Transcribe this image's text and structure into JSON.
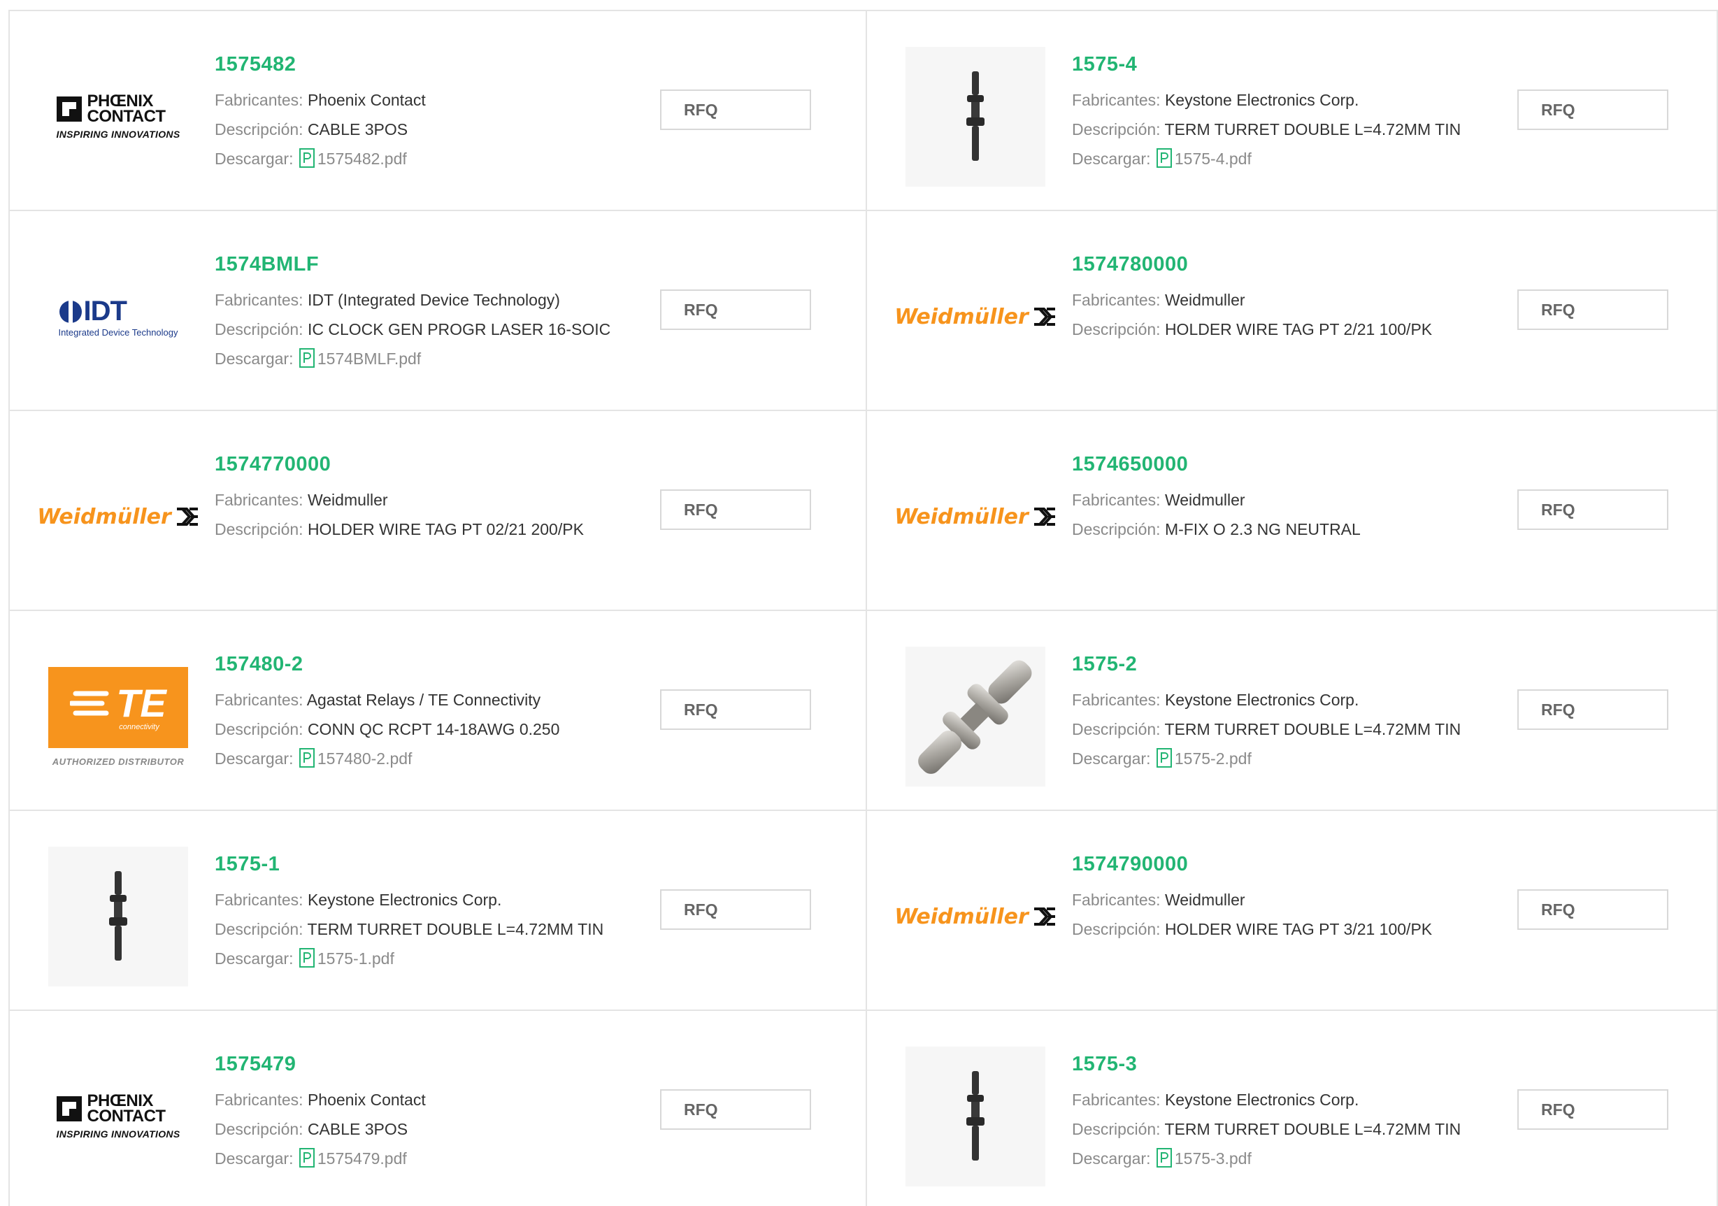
{
  "labels": {
    "manufacturer": "Fabricantes:",
    "description": "Descripción:",
    "download": "Descargar:",
    "rfq": "RFQ"
  },
  "products": [
    {
      "part": "1575482",
      "manufacturer": "Phoenix Contact",
      "description": "CABLE 3POS",
      "pdf": "1575482.pdf",
      "logo": "phoenix-contact-logo"
    },
    {
      "part": "1575-4",
      "manufacturer": "Keystone Electronics Corp.",
      "description": "TERM TURRET DOUBLE L=4.72MM TIN",
      "pdf": "1575-4.pdf",
      "logo": "turret-terminal-photo"
    },
    {
      "part": "1574BMLF",
      "manufacturer": "IDT (Integrated Device Technology)",
      "description": "IC CLOCK GEN PROGR LASER 16-SOIC",
      "pdf": "1574BMLF.pdf",
      "logo": "idt-logo"
    },
    {
      "part": "1574780000",
      "manufacturer": "Weidmuller",
      "description": "HOLDER WIRE TAG PT 2/21 100/PK",
      "pdf": null,
      "logo": "weidmuller-logo"
    },
    {
      "part": "1574770000",
      "manufacturer": "Weidmuller",
      "description": "HOLDER WIRE TAG PT 02/21 200/PK",
      "pdf": null,
      "logo": "weidmuller-logo"
    },
    {
      "part": "1574650000",
      "manufacturer": "Weidmuller",
      "description": "M-FIX O 2.3 NG NEUTRAL",
      "pdf": null,
      "logo": "weidmuller-logo"
    },
    {
      "part": "157480-2",
      "manufacturer": "Agastat Relays / TE Connectivity",
      "description": "CONN QC RCPT 14-18AWG 0.250",
      "pdf": "157480-2.pdf",
      "logo": "te-connectivity-logo"
    },
    {
      "part": "1575-2",
      "manufacturer": "Keystone Electronics Corp.",
      "description": "TERM TURRET DOUBLE L=4.72MM TIN",
      "pdf": "1575-2.pdf",
      "logo": "turret-terminal-metal-photo"
    },
    {
      "part": "1575-1",
      "manufacturer": "Keystone Electronics Corp.",
      "description": "TERM TURRET DOUBLE L=4.72MM TIN",
      "pdf": "1575-1.pdf",
      "logo": "turret-terminal-photo"
    },
    {
      "part": "1574790000",
      "manufacturer": "Weidmuller",
      "description": "HOLDER WIRE TAG PT 3/21 100/PK",
      "pdf": null,
      "logo": "weidmuller-logo"
    },
    {
      "part": "1575479",
      "manufacturer": "Phoenix Contact",
      "description": "CABLE 3POS",
      "pdf": "1575479.pdf",
      "logo": "phoenix-contact-logo"
    },
    {
      "part": "1575-3",
      "manufacturer": "Keystone Electronics Corp.",
      "description": "TERM TURRET DOUBLE L=4.72MM TIN",
      "pdf": "1575-3.pdf",
      "logo": "turret-terminal-photo"
    }
  ],
  "logo_text": {
    "phoenix_name_1": "PHŒNIX",
    "phoenix_name_2": "CONTACT",
    "phoenix_tagline": "INSPIRING INNOVATIONS",
    "idt_name": "IDT",
    "idt_sub": "Integrated Device Technology",
    "weidmuller": "Weidmüller",
    "te_name": "TE",
    "te_sub": "connectivity",
    "te_authorized": "AUTHORIZED DISTRIBUTOR"
  },
  "colors": {
    "part_number": "#22b573",
    "weidmuller_orange": "#f7941d",
    "te_orange": "#f7941d",
    "idt_blue": "#1b3a8a",
    "pdf_icon_green": "#22b573"
  }
}
